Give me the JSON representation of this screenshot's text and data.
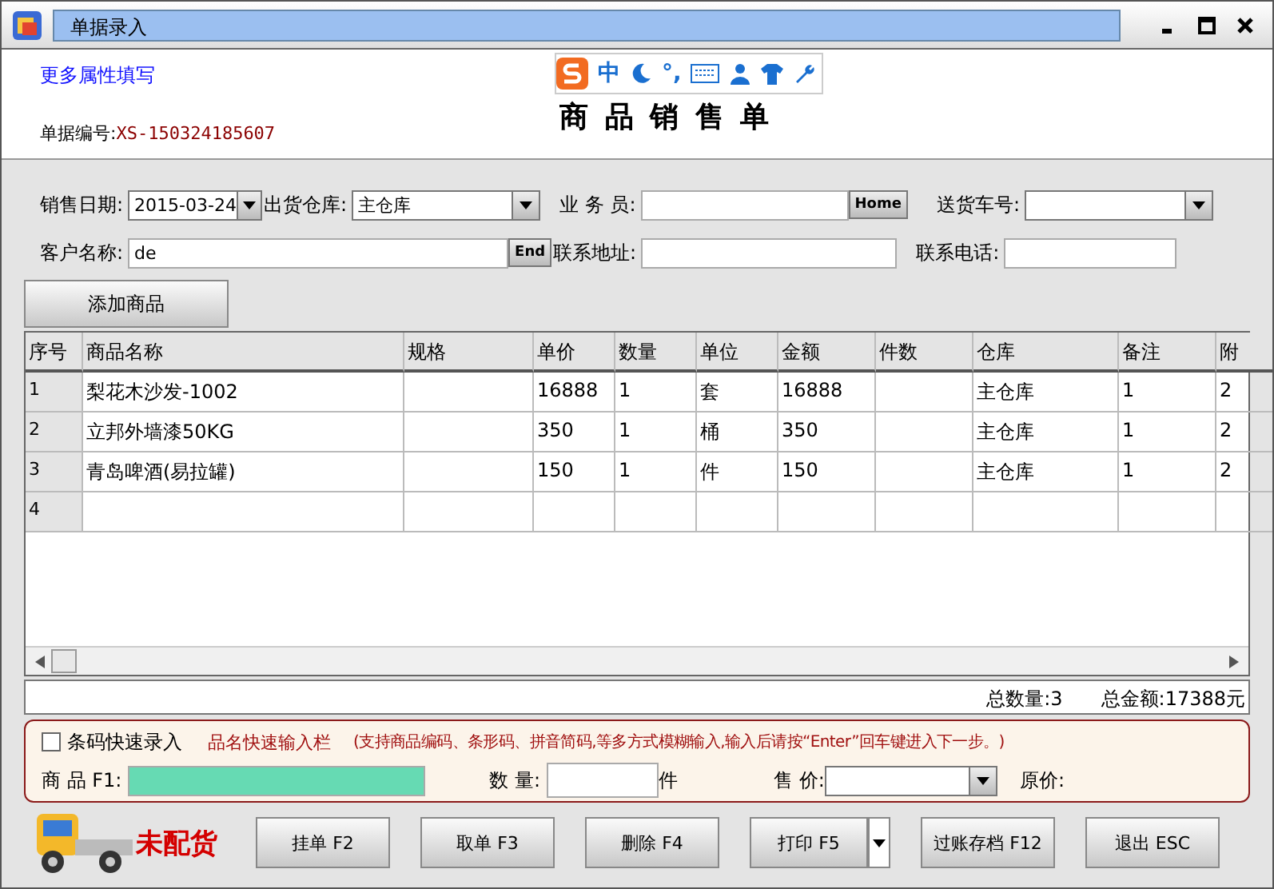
{
  "window": {
    "title": "单据录入"
  },
  "header": {
    "more_link": "更多属性填写",
    "title": "商 品 销 售 单",
    "doc_no_label": "单据编号:",
    "doc_no": "XS-150324185607"
  },
  "ime_toolbar": {
    "mode": "中",
    "punct": "°,"
  },
  "form": {
    "row1": [
      {
        "kind": "date",
        "label": "销售日期:",
        "value": "2015-03-24"
      },
      {
        "kind": "select",
        "label": "出货仓库:",
        "value": "主仓库"
      },
      {
        "kind": "lookup",
        "label": "业 务 员:",
        "button": "Home"
      },
      {
        "kind": "select",
        "label": "送货车号:"
      }
    ],
    "row2": [
      {
        "kind": "lookup",
        "label": "客户名称:",
        "value": "de",
        "button": "End"
      },
      {
        "kind": "text",
        "label": "联系地址:"
      },
      {
        "kind": "text",
        "label": "联系电话:"
      }
    ],
    "add_button": "添加商品"
  },
  "table": {
    "columns": [
      "序号",
      "商品名称",
      "规格",
      "单价",
      "数量",
      "单位",
      "金额",
      "件数",
      "仓库",
      "备注",
      "附"
    ],
    "rows": [
      [
        "1",
        "梨花木沙发-1002",
        "",
        "16888",
        "1",
        "套",
        "16888",
        "",
        "主仓库",
        "1",
        "2"
      ],
      [
        "2",
        "立邦外墙漆50KG",
        "",
        "350",
        "1",
        "桶",
        "350",
        "",
        "主仓库",
        "1",
        "2"
      ],
      [
        "3",
        "青岛啤酒(易拉罐)",
        "",
        "150",
        "1",
        "件",
        "150",
        "",
        "主仓库",
        "1",
        "2"
      ],
      [
        "4",
        "",
        "",
        "",
        "",
        "",
        "",
        "",
        "",
        "",
        ""
      ]
    ]
  },
  "totals": {
    "quantity": "总数量:3",
    "amount": "总金额:17388元"
  },
  "quick_entry": {
    "barcode_label": "条码快速录入",
    "barcode_checked": false,
    "title": "品名快速输入栏",
    "hint": "(支持商品编码、条形码、拼音简码,等多方式模糊输入,输入后请按“Enter”回车键进入下一步。)",
    "product_label": "商 品 F1:",
    "qty_label": "数 量:",
    "qty_unit": "件",
    "price_label": "售 价:",
    "orig_price_label": "原价:"
  },
  "status": "未配货",
  "buttons": [
    {
      "label": "挂单 F2",
      "menu": false
    },
    {
      "label": "取单 F3",
      "menu": false
    },
    {
      "label": "删除 F4",
      "menu": false
    },
    {
      "label": "打印 F5",
      "menu": true
    },
    {
      "label": "过账存档 F12",
      "menu": false
    },
    {
      "label": "退出 ESC",
      "menu": false
    }
  ]
}
